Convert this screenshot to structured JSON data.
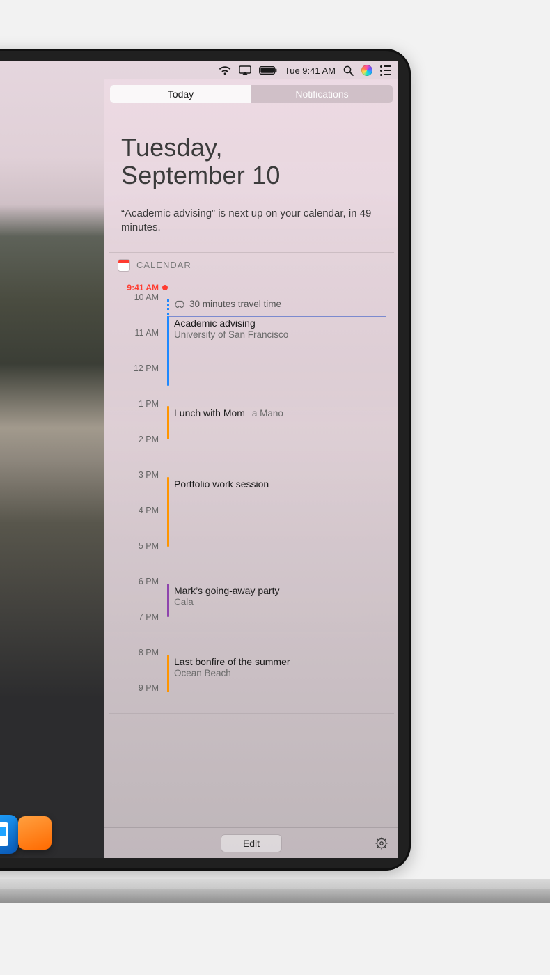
{
  "menubar": {
    "time": "Tue 9:41 AM"
  },
  "tabs": {
    "today": "Today",
    "notifications": "Notifications",
    "active": "today"
  },
  "date": {
    "line1": "Tuesday,",
    "line2": "September 10"
  },
  "summary": "“Academic advising” is next up on your calendar, in 49 minutes.",
  "widget": {
    "title": "CALENDAR"
  },
  "now": {
    "label": "9:41 AM"
  },
  "hours": [
    "10 AM",
    "11 AM",
    "12 PM",
    "1 PM",
    "2 PM",
    "3 PM",
    "4 PM",
    "5 PM",
    "6 PM",
    "7 PM",
    "8 PM",
    "9 PM"
  ],
  "travel": {
    "text": "30 minutes travel time"
  },
  "events": [
    {
      "id": "advising",
      "title": "Academic advising",
      "loc": "University of San Francisco",
      "color": "#1e88ff"
    },
    {
      "id": "lunch",
      "title": "Lunch with Mom",
      "loc": "a Mano",
      "color": "#ff9500"
    },
    {
      "id": "portfolio",
      "title": "Portfolio work session",
      "loc": "",
      "color": "#ff9500"
    },
    {
      "id": "party",
      "title": "Mark’s going-away party",
      "loc": "Cala",
      "color": "#8e44ad"
    },
    {
      "id": "bonfire",
      "title": "Last bonfire of the summer",
      "loc": "Ocean Beach",
      "color": "#ff9500"
    }
  ],
  "edit": "Edit"
}
